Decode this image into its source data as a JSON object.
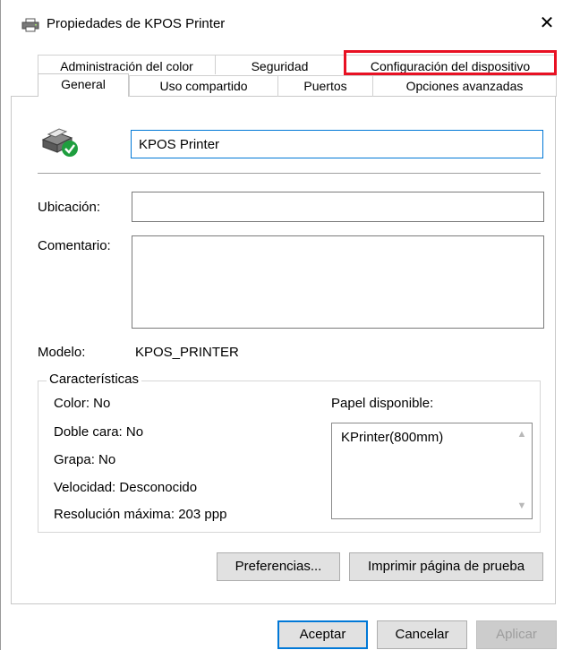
{
  "window": {
    "title": "Propiedades de KPOS Printer",
    "close_glyph": "✕",
    "icon": "printer-icon"
  },
  "tabs": {
    "row1": [
      "Administración del color",
      "Seguridad",
      "Configuración del dispositivo"
    ],
    "row2": [
      "General",
      "Uso compartido",
      "Puertos",
      "Opciones avanzadas"
    ],
    "active": "General",
    "highlighted": "Configuración del dispositivo",
    "highlight_color": "#e81123"
  },
  "general": {
    "printer_name": "KPOS Printer",
    "printer_icon": "printer-ready-icon",
    "ubicacion_label": "Ubicación:",
    "ubicacion_value": "",
    "comentario_label": "Comentario:",
    "comentario_value": "",
    "modelo_label": "Modelo:",
    "modelo_value": "KPOS_PRINTER"
  },
  "caracteristicas": {
    "title": "Características",
    "color": "Color: No",
    "doble_cara": "Doble cara: No",
    "grapa": "Grapa: No",
    "velocidad": "Velocidad: Desconocido",
    "resolucion": "Resolución máxima: 203 ppp",
    "papel_label": "Papel disponible:",
    "papel_items": [
      "KPrinter(800mm)"
    ]
  },
  "buttons": {
    "preferencias": "Preferencias...",
    "imprimir_prueba": "Imprimir página de prueba",
    "aceptar": "Aceptar",
    "cancelar": "Cancelar",
    "aplicar": "Aplicar"
  },
  "colors": {
    "focus_blue": "#0078d7",
    "ok_green": "#1e9e3e"
  }
}
